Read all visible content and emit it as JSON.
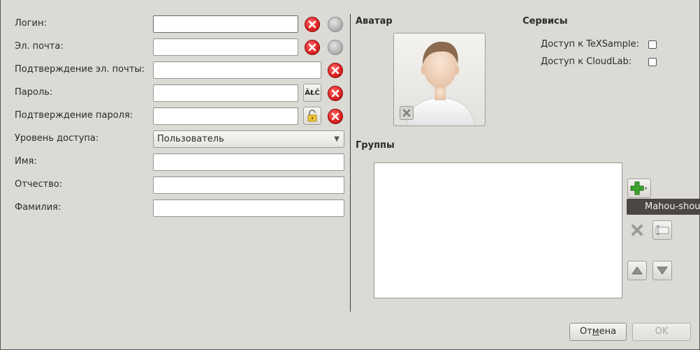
{
  "form": {
    "login_label": "Логин:",
    "email_label": "Эл. почта:",
    "email_confirm_label": "Подтверждение эл. почты:",
    "password_label": "Пароль:",
    "password_confirm_label": "Подтверждение пароля:",
    "access_level_label": "Уровень доступа:",
    "access_level_value": "Пользователь",
    "name_label": "Имя:",
    "patronymic_label": "Отчество:",
    "surname_label": "Фамилия:",
    "charset_button_label": "ÂŁČ"
  },
  "avatar": {
    "heading": "Аватар"
  },
  "services": {
    "heading": "Сервисы",
    "items": [
      {
        "label": "Доступ к TeXSample:",
        "checked": false
      },
      {
        "label": "Доступ к CloudLab:",
        "checked": false
      }
    ]
  },
  "groups": {
    "heading": "Группы",
    "items": [],
    "tooltip": "Mahou-shoujo"
  },
  "dialog": {
    "cancel_prefix": "От",
    "cancel_mnemonic": "м",
    "cancel_suffix": "ена",
    "ok_label": "OK"
  },
  "colors": {
    "error_red": "#e02424",
    "add_green": "#3aa52a",
    "tooltip_bg": "#4c4743",
    "window_bg": "#dcdad5"
  },
  "icons": {
    "error": "error-x-icon",
    "globe": "globe-icon",
    "lock": "lock-icon",
    "add": "add-plus-icon",
    "remove": "remove-x-icon",
    "rename": "rename-field-icon",
    "up": "arrow-up-icon",
    "down": "arrow-down-icon"
  }
}
